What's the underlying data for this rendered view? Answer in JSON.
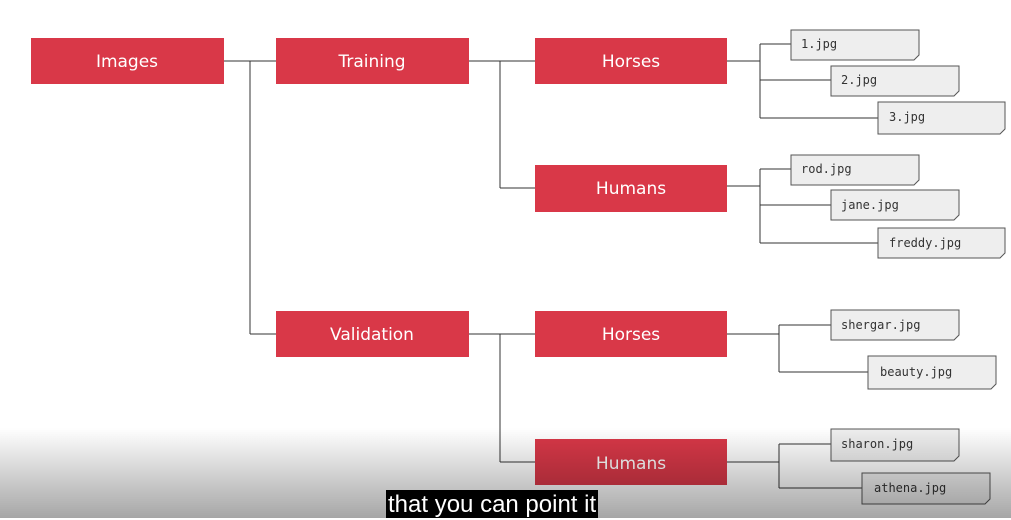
{
  "colors": {
    "folder_fill": "#d93848",
    "file_fill": "#eeeeee",
    "file_stroke": "#555555",
    "connector": "#333333",
    "background": "#ffffff"
  },
  "tree": {
    "root": "Images",
    "training": {
      "label": "Training",
      "horses": {
        "label": "Horses",
        "files": [
          "1.jpg",
          "2.jpg",
          "3.jpg"
        ]
      },
      "humans": {
        "label": "Humans",
        "files": [
          "rod.jpg",
          "jane.jpg",
          "freddy.jpg"
        ]
      }
    },
    "validation": {
      "label": "Validation",
      "horses": {
        "label": "Horses",
        "files": [
          "shergar.jpg",
          "beauty.jpg"
        ]
      },
      "humans": {
        "label": "Humans",
        "files": [
          "sharon.jpg",
          "athena.jpg"
        ]
      }
    }
  },
  "caption": {
    "text": "that you can point it"
  }
}
